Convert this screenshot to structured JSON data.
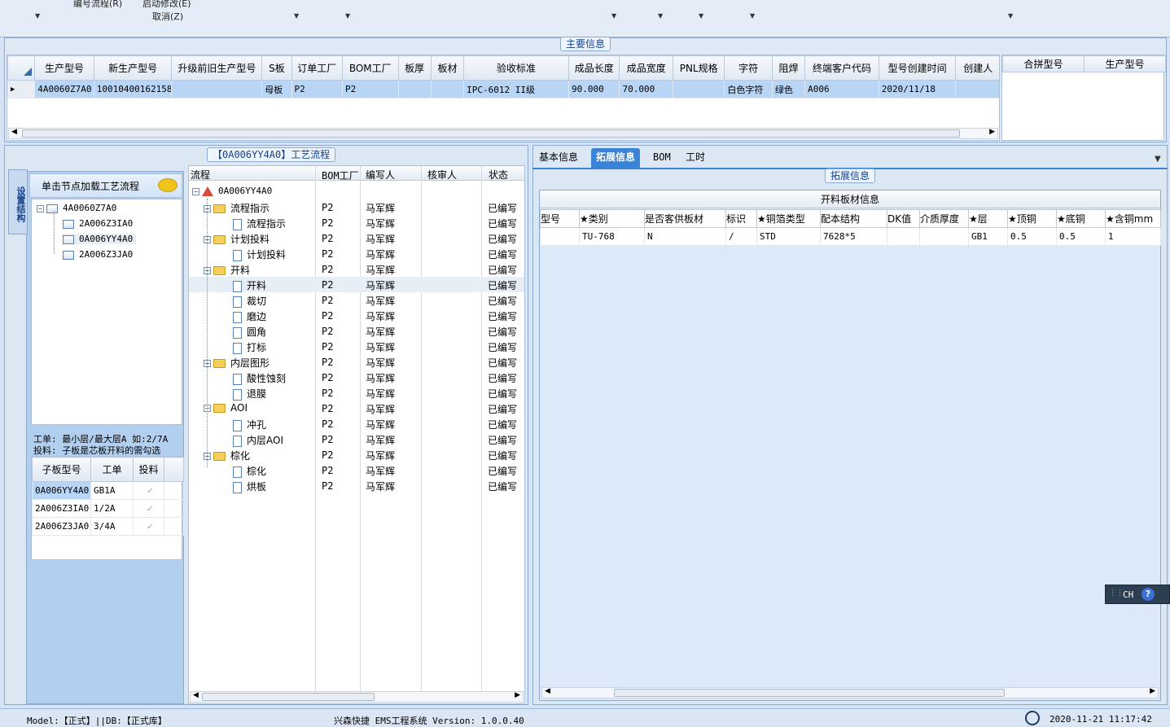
{
  "toolbar": {
    "item1": "编号流程(R)",
    "item2": "启动修改(E)",
    "item3": "取消(Z)"
  },
  "main": {
    "group_title": "主要信息",
    "columns": [
      "生产型号",
      "新生产型号",
      "升级前旧生产型号",
      "S板",
      "订单工厂",
      "BOM工厂",
      "板厚",
      "板材",
      "验收标准",
      "成品长度",
      "成品宽度",
      "PNL规格",
      "字符",
      "阻焊",
      "终端客户代码",
      "型号创建时间",
      "创建人"
    ],
    "row": [
      "4A0060Z7A0",
      "10010400162158",
      "",
      "母板",
      "P2",
      "P2",
      "",
      "",
      "IPC-6012 II级",
      "90.000",
      "70.000",
      "",
      "白色字符",
      "绿色",
      "A006",
      "2020/11/18",
      ""
    ],
    "side_columns": [
      "合拼型号",
      "生产型号"
    ]
  },
  "process": {
    "title": "【0A006YY4A0】工艺流程",
    "vertical_tab": "设置结构",
    "load_hint": "单击节点加载工艺流程",
    "tree_root": "4A0060Z7A0",
    "tree_children": [
      "2A006Z3IA0",
      "0A006YY4A0",
      "2A006Z3JA0"
    ],
    "note_line1": "工单: 最小层/最大层A 如:2/7A",
    "note_line2": "投料: 子板是芯板开料的需勾选",
    "sub_columns": [
      "子板型号",
      "工单",
      "投料"
    ],
    "sub_rows": [
      {
        "model": "0A006YY4A0",
        "order": "GB1A",
        "checked": "✓"
      },
      {
        "model": "2A006Z3IA0",
        "order": "1/2A",
        "checked": "✓"
      },
      {
        "model": "2A006Z3JA0",
        "order": "3/4A",
        "checked": "✓"
      }
    ],
    "flow_columns": [
      "流程",
      "BOM工厂",
      "编写人",
      "核审人",
      "状态"
    ],
    "flow_root": "0A006YY4A0",
    "flow_rows": [
      {
        "name": "流程指示",
        "level": 1,
        "bom": "P2",
        "writer": "马军辉",
        "status": "已编写"
      },
      {
        "name": "流程指示",
        "level": 2,
        "bom": "P2",
        "writer": "马军辉",
        "status": "已编写"
      },
      {
        "name": "计划投料",
        "level": 1,
        "bom": "P2",
        "writer": "马军辉",
        "status": "已编写"
      },
      {
        "name": "计划投料",
        "level": 2,
        "bom": "P2",
        "writer": "马军辉",
        "status": "已编写"
      },
      {
        "name": "开料",
        "level": 1,
        "bom": "P2",
        "writer": "马军辉",
        "status": "已编写"
      },
      {
        "name": "开料",
        "level": 2,
        "bom": "P2",
        "writer": "马军辉",
        "status": "已编写"
      },
      {
        "name": "裁切",
        "level": 2,
        "bom": "P2",
        "writer": "马军辉",
        "status": "已编写"
      },
      {
        "name": "磨边",
        "level": 2,
        "bom": "P2",
        "writer": "马军辉",
        "status": "已编写"
      },
      {
        "name": "圆角",
        "level": 2,
        "bom": "P2",
        "writer": "马军辉",
        "status": "已编写"
      },
      {
        "name": "打标",
        "level": 2,
        "bom": "P2",
        "writer": "马军辉",
        "status": "已编写"
      },
      {
        "name": "内层图形",
        "level": 1,
        "bom": "P2",
        "writer": "马军辉",
        "status": "已编写"
      },
      {
        "name": "酸性蚀刻",
        "level": 2,
        "bom": "P2",
        "writer": "马军辉",
        "status": "已编写"
      },
      {
        "name": "退膜",
        "level": 2,
        "bom": "P2",
        "writer": "马军辉",
        "status": "已编写"
      },
      {
        "name": "AOI",
        "level": 1,
        "bom": "P2",
        "writer": "马军辉",
        "status": "已编写"
      },
      {
        "name": "冲孔",
        "level": 2,
        "bom": "P2",
        "writer": "马军辉",
        "status": "已编写"
      },
      {
        "name": "内层AOI",
        "level": 2,
        "bom": "P2",
        "writer": "马军辉",
        "status": "已编写"
      },
      {
        "name": "棕化",
        "level": 1,
        "bom": "P2",
        "writer": "马军辉",
        "status": "已编写"
      },
      {
        "name": "棕化",
        "level": 2,
        "bom": "P2",
        "writer": "马军辉",
        "status": "已编写"
      },
      {
        "name": "烘板",
        "level": 2,
        "bom": "P2",
        "writer": "马军辉",
        "status": "已编写"
      }
    ]
  },
  "right": {
    "tabs": [
      "基本信息",
      "拓展信息",
      "BOM",
      "工时"
    ],
    "active_tab": "拓展信息",
    "group_title": "拓展信息",
    "table_title": "开料板材信息",
    "columns": [
      "型号",
      "★类别",
      "是否客供板材",
      "标识",
      "★铜箔类型",
      "配本结构",
      "DK值",
      "介质厚度",
      "★层",
      "★顶铜",
      "★底铜",
      "★含铜mm"
    ],
    "row": [
      "",
      "TU-768",
      "N",
      "/",
      "STD",
      "7628*5",
      "",
      "",
      "GB1",
      "0.5",
      "0.5",
      "1"
    ]
  },
  "status": {
    "model": "Model:【正式】||DB:【正式库】",
    "app": "兴森快捷 EMS工程系统 Version: 1.0.0.40",
    "time": "2020-11-21 11:17:42"
  },
  "ime": {
    "label": "CH"
  }
}
